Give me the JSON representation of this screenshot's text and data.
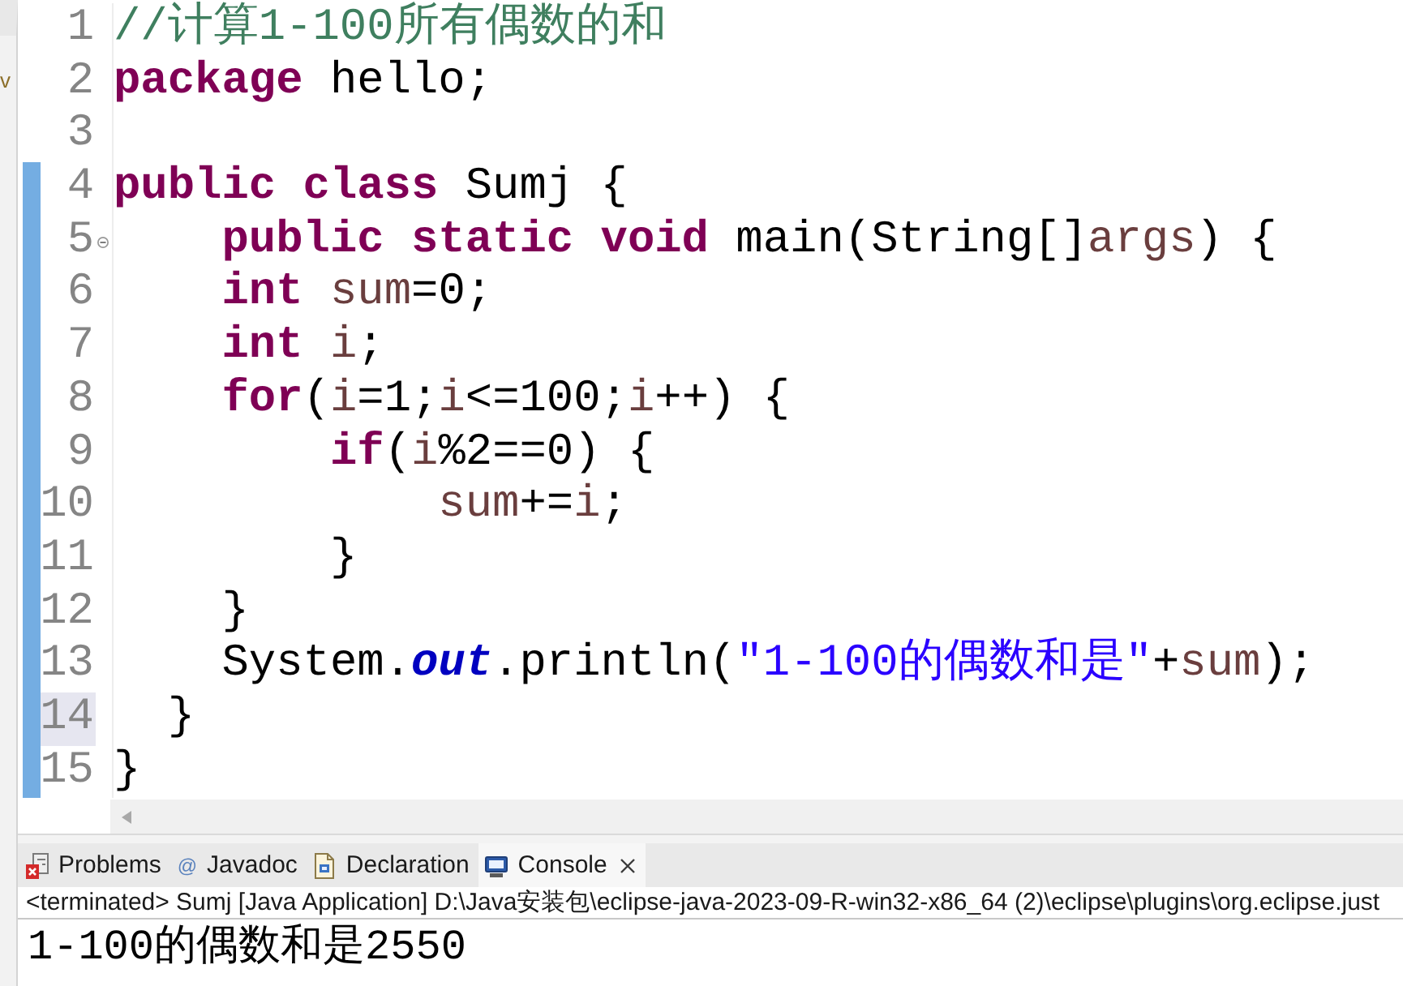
{
  "side_panel": {
    "label": "v"
  },
  "editor": {
    "lines": [
      {
        "number": "1",
        "changed": false,
        "current": false,
        "foldable": false,
        "tokens": [
          {
            "kind": "comment",
            "text": "//计算1-100所有偶数的和"
          }
        ]
      },
      {
        "number": "2",
        "changed": false,
        "current": false,
        "foldable": false,
        "tokens": [
          {
            "kind": "keyword",
            "text": "package"
          },
          {
            "kind": "plain",
            "text": " hello;"
          }
        ]
      },
      {
        "number": "3",
        "changed": false,
        "current": false,
        "foldable": false
      },
      {
        "number": "4",
        "changed": true,
        "current": false,
        "foldable": false,
        "tokens": [
          {
            "kind": "keyword",
            "text": "public class"
          },
          {
            "kind": "plain",
            "text": " Sumj {"
          }
        ]
      },
      {
        "number": "5",
        "changed": true,
        "current": false,
        "foldable": true,
        "tokens": [
          {
            "kind": "keyword",
            "text": "    public static void"
          },
          {
            "kind": "plain",
            "text": " main(String[]"
          },
          {
            "kind": "variable",
            "text": "args"
          },
          {
            "kind": "plain",
            "text": ") {"
          }
        ]
      },
      {
        "number": "6",
        "changed": true,
        "current": false,
        "foldable": false,
        "tokens": [
          {
            "kind": "keyword",
            "text": "    int "
          },
          {
            "kind": "variable",
            "text": "sum"
          },
          {
            "kind": "plain",
            "text": "=0;"
          }
        ]
      },
      {
        "number": "7",
        "changed": true,
        "current": false,
        "foldable": false,
        "tokens": [
          {
            "kind": "keyword",
            "text": "    int "
          },
          {
            "kind": "variable",
            "text": "i"
          },
          {
            "kind": "plain",
            "text": ";"
          }
        ]
      },
      {
        "number": "8",
        "changed": true,
        "current": false,
        "foldable": false,
        "tokens": [
          {
            "kind": "keyword",
            "text": "    for"
          },
          {
            "kind": "plain",
            "text": "("
          },
          {
            "kind": "variable",
            "text": "i"
          },
          {
            "kind": "plain",
            "text": "=1;"
          },
          {
            "kind": "variable",
            "text": "i"
          },
          {
            "kind": "plain",
            "text": "<=100;"
          },
          {
            "kind": "variable",
            "text": "i"
          },
          {
            "kind": "plain",
            "text": "++) {"
          }
        ]
      },
      {
        "number": "9",
        "changed": true,
        "current": false,
        "foldable": false,
        "tokens": [
          {
            "kind": "keyword",
            "text": "        if"
          },
          {
            "kind": "plain",
            "text": "("
          },
          {
            "kind": "variable",
            "text": "i"
          },
          {
            "kind": "plain",
            "text": "%2==0) {"
          }
        ]
      },
      {
        "number": "10",
        "changed": true,
        "current": false,
        "foldable": false,
        "tokens": [
          {
            "kind": "variable",
            "text": "            sum"
          },
          {
            "kind": "plain",
            "text": "+="
          },
          {
            "kind": "variable",
            "text": "i"
          },
          {
            "kind": "plain",
            "text": ";"
          }
        ]
      },
      {
        "number": "11",
        "changed": true,
        "current": false,
        "foldable": false,
        "tokens": [
          {
            "kind": "plain",
            "text": "        }"
          }
        ]
      },
      {
        "number": "12",
        "changed": true,
        "current": false,
        "foldable": false,
        "tokens": [
          {
            "kind": "plain",
            "text": "    }"
          }
        ]
      },
      {
        "number": "13",
        "changed": true,
        "current": false,
        "foldable": false,
        "tokens": [
          {
            "kind": "plain",
            "text": "    System."
          },
          {
            "kind": "field",
            "text": "out"
          },
          {
            "kind": "plain",
            "text": ".println("
          },
          {
            "kind": "string",
            "text": "\"1-100的偶数和是\""
          },
          {
            "kind": "plain",
            "text": "+"
          },
          {
            "kind": "variable",
            "text": "sum"
          },
          {
            "kind": "plain",
            "text": ");"
          }
        ]
      },
      {
        "number": "14",
        "changed": true,
        "current": true,
        "foldable": false,
        "tokens": [
          {
            "kind": "plain",
            "text": "  }"
          }
        ]
      },
      {
        "number": "15",
        "changed": true,
        "current": false,
        "foldable": false,
        "tokens": [
          {
            "kind": "plain",
            "text": "}"
          }
        ]
      }
    ]
  },
  "bottom_panel": {
    "tabs": [
      {
        "label": "Problems",
        "selected": false,
        "closable": false
      },
      {
        "label": "Javadoc",
        "glyph": "@",
        "selected": false,
        "closable": false
      },
      {
        "label": "Declaration",
        "selected": false,
        "closable": false
      },
      {
        "label": "Console",
        "selected": true,
        "closable": true
      }
    ],
    "console": {
      "status": "<terminated> Sumj [Java Application] D:\\Java安装包\\eclipse-java-2023-09-R-win32-x86_64 (2)\\eclipse\\plugins\\org.eclipse.just",
      "output": "1-100的偶数和是2550"
    }
  }
}
